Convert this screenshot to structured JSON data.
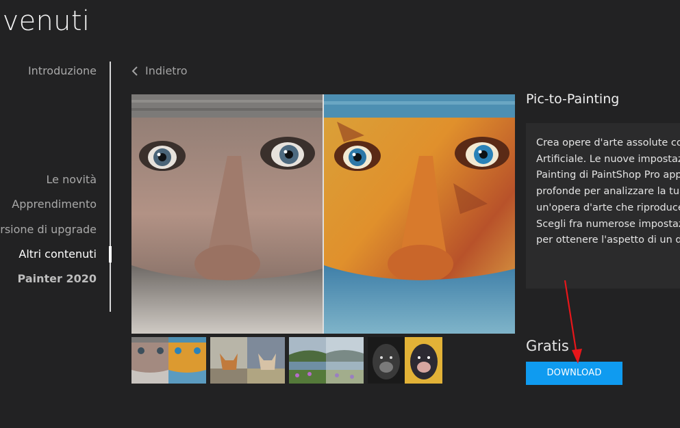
{
  "header": {
    "title": "nvenuti"
  },
  "sidebar": {
    "items": [
      {
        "label": "Introduzione",
        "state": "normal"
      },
      {
        "label": "Le novità",
        "state": "normal"
      },
      {
        "label": "Apprendimento",
        "state": "normal"
      },
      {
        "label": "ersione di upgrade",
        "state": "normal"
      },
      {
        "label": "Altri contenuti",
        "state": "active"
      },
      {
        "label": "Painter 2020",
        "state": "bold"
      }
    ]
  },
  "nav": {
    "back_label": "Indietro"
  },
  "product": {
    "title": "Pic-to-Painting",
    "description_lines": [
      "Crea opere d'arte assolute con",
      "Artificiale. Le nuove impostazi",
      "Painting di PaintShop Pro app",
      "profonde per analizzare la tua",
      "un'opera d'arte che riproduce",
      "Scegli fra numerose impostazi",
      "per ottenere l'aspetto di un di"
    ],
    "price": "Gratis",
    "download_label": "DOWNLOAD"
  },
  "thumbnails": [
    {
      "subject": "old-man-portrait"
    },
    {
      "subject": "fox-cubs"
    },
    {
      "subject": "lake-landscape"
    },
    {
      "subject": "gorilla"
    }
  ],
  "colors": {
    "background": "#222223",
    "panel": "#2b2b2c",
    "accent": "#0f9bf0",
    "annotation": "#e8161a"
  }
}
